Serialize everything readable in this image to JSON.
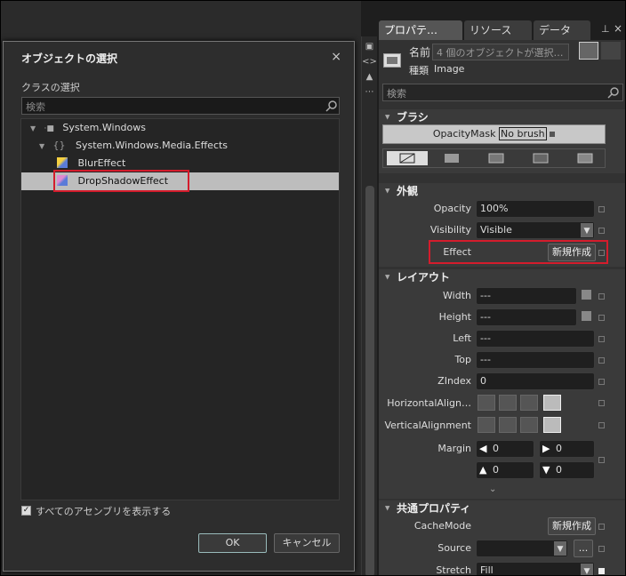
{
  "tabs": {
    "properties": "プロパテ…",
    "resources": "リソース(O)",
    "data": "データ(D)"
  },
  "header": {
    "name_label": "名前",
    "name_value": "4 個のオブジェクトが選択…",
    "type_label": "種類",
    "type_value": "Image"
  },
  "search_placeholder": "検索",
  "brush": {
    "title": "ブラシ",
    "opacitymask": "OpacityMask",
    "no_brush": "No brush"
  },
  "appearance": {
    "title": "外観",
    "opacity_label": "Opacity",
    "opacity_value": "100%",
    "visibility_label": "Visibility",
    "visibility_value": "Visible",
    "effect_label": "Effect",
    "effect_button": "新規作成"
  },
  "layout": {
    "title": "レイアウト",
    "width_label": "Width",
    "width_value": "---",
    "height_label": "Height",
    "height_value": "---",
    "left_label": "Left",
    "left_value": "---",
    "top_label": "Top",
    "top_value": "---",
    "zindex_label": "ZIndex",
    "zindex_value": "0",
    "halign_label": "HorizontalAlign…",
    "valign_label": "VerticalAlignment",
    "margin_label": "Margin",
    "margin_left": "0",
    "margin_right": "0",
    "margin_top": "0",
    "margin_bottom": "0"
  },
  "common": {
    "title": "共通プロパティ",
    "cachemode_label": "CacheMode",
    "cachemode_button": "新規作成",
    "source_label": "Source",
    "source_button": "...",
    "stretch_label": "Stretch",
    "stretch_value": "Fill"
  },
  "dialog": {
    "title": "オブジェクトの選択",
    "close": "×",
    "class_label": "クラスの選択",
    "search_placeholder": "検索",
    "tree": [
      {
        "label": "System.Windows",
        "icon": "·■"
      },
      {
        "label": "System.Windows.Media.Effects",
        "icon": "{}"
      },
      {
        "label": "BlurEffect"
      },
      {
        "label": "DropShadowEffect"
      }
    ],
    "show_all": "すべてのアセンブリを表示する",
    "ok": "OK",
    "cancel": "キャンセル"
  }
}
